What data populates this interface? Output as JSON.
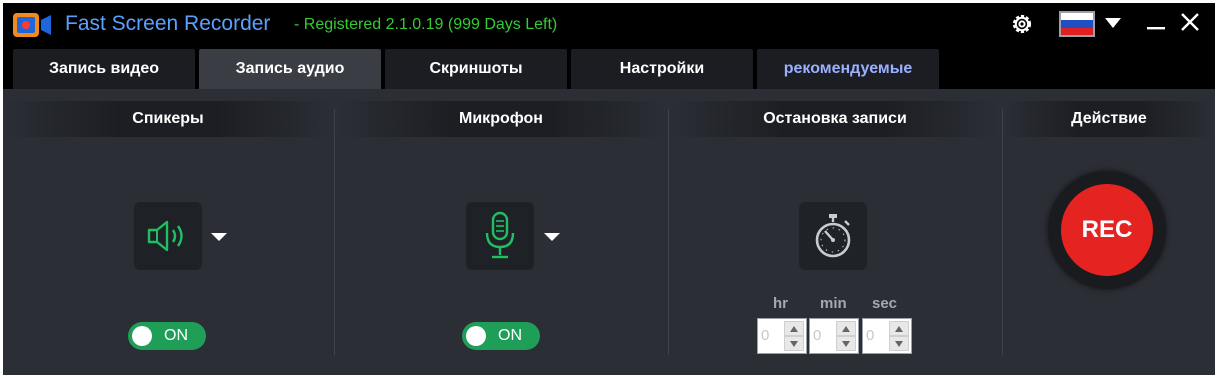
{
  "titlebar": {
    "app_name": "Fast Screen Recorder",
    "registration": "- Registered 2.1.0.19 (999 Days Left)",
    "icons": [
      "app-logo-icon",
      "gear-icon",
      "flag-russia-icon",
      "chevron-down-icon",
      "minimize-icon",
      "close-icon"
    ]
  },
  "tabs": [
    {
      "label": "Запись видео",
      "active": false
    },
    {
      "label": "Запись аудио",
      "active": true
    },
    {
      "label": "Скриншоты",
      "active": false
    },
    {
      "label": "Настройки",
      "active": false
    },
    {
      "label": "рекомендуемые",
      "active": false
    }
  ],
  "speakers": {
    "title": "Спикеры",
    "toggle": "ON",
    "icon": "speaker-icon"
  },
  "microphone": {
    "title": "Микрофон",
    "toggle": "ON",
    "icon": "microphone-icon"
  },
  "stop": {
    "title": "Остановка записи",
    "icon": "stopwatch-icon",
    "labels": {
      "hr": "hr",
      "min": "min",
      "sec": "sec"
    },
    "values": {
      "hr": "0",
      "min": "0",
      "sec": "0"
    }
  },
  "action": {
    "title": "Действие",
    "rec": "REC"
  },
  "colors": {
    "accent_green": "#1f9e58",
    "rec_red": "#e52320",
    "title_blue": "#5aa0ff",
    "reg_green": "#33cc33"
  }
}
